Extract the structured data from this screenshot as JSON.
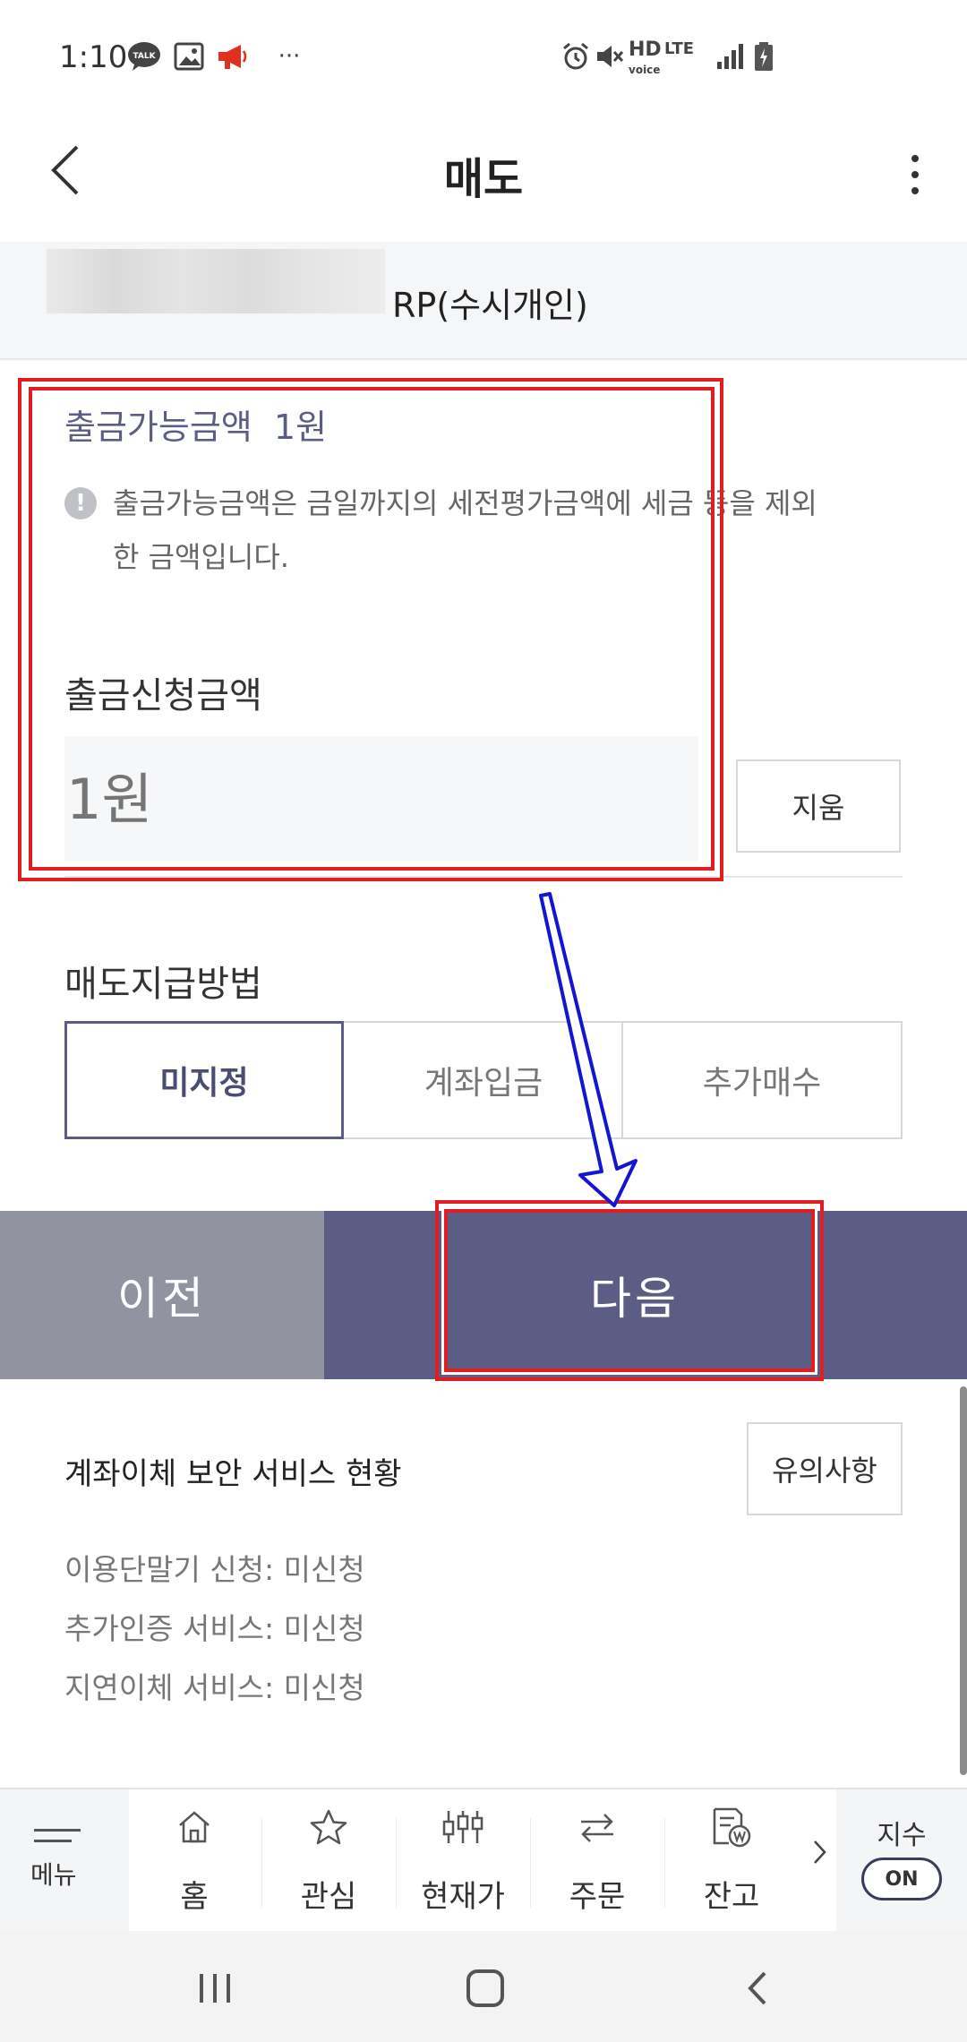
{
  "status_bar": {
    "time": "1:10",
    "icons": [
      "talk-icon",
      "gallery-icon",
      "megaphone-icon",
      "more-dots-icon",
      "alarm-icon",
      "mute-icon",
      "hd-voice-icon",
      "lte-icon",
      "signal-icon",
      "battery-icon"
    ],
    "talk_badge": "TALK",
    "dots": "···",
    "hd": "HD",
    "lte": "LTE"
  },
  "header": {
    "title": "매도"
  },
  "account": {
    "name": "RP(수시개인)"
  },
  "withdrawal": {
    "available_label": "출금가능금액  1원",
    "info_text": "출금가능금액은 금일까지의 세전평가금액에 세금 등을 제외한 금액입니다.",
    "request_label": "출금신청금액",
    "amount_placeholder": "1원",
    "clear_label": "지움"
  },
  "payment_method": {
    "label": "매도지급방법",
    "options": [
      "미지정",
      "계좌입금",
      "추가매수"
    ],
    "selected": "미지정"
  },
  "actions": {
    "prev_label": "이전",
    "next_label": "다음"
  },
  "security": {
    "title": "계좌이체 보안 서비스 현황",
    "notice_label": "유의사항",
    "rows": [
      "이용단말기 신청: 미신청",
      "추가인증 서비스: 미신청",
      "지연이체 서비스: 미신청"
    ]
  },
  "bottom_nav": {
    "menu_label": "메뉴",
    "items": [
      {
        "label": "홈",
        "icon": "home-icon"
      },
      {
        "label": "관심",
        "icon": "star-icon"
      },
      {
        "label": "현재가",
        "icon": "candlestick-icon"
      },
      {
        "label": "주문",
        "icon": "swap-icon"
      },
      {
        "label": "잔고",
        "icon": "balance-icon"
      }
    ],
    "index_label": "지수",
    "index_toggle": "ON"
  },
  "colors": {
    "primary": "#5b5d85",
    "prev_button": "#9194a0",
    "annotation_red": "#e11d24",
    "annotation_arrow": "#1414d4"
  }
}
